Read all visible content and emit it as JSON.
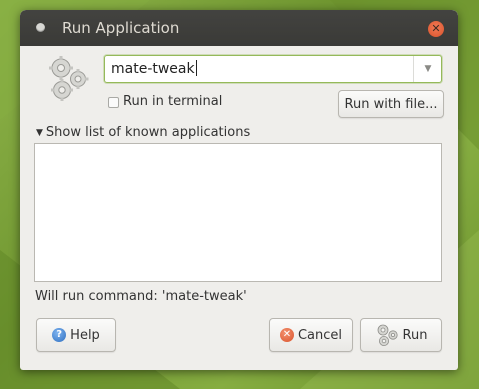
{
  "window": {
    "title": "Run Application",
    "close_glyph": "✕"
  },
  "command": {
    "value": "mate-tweak",
    "dropdown_glyph": "▼"
  },
  "options": {
    "run_in_terminal_label": "Run in terminal",
    "run_in_terminal_checked": false,
    "run_with_file_label": "Run with file..."
  },
  "known_apps": {
    "toggle_label": "Show list of known applications",
    "toggle_glyph": "▼",
    "items": []
  },
  "status": {
    "will_run_text": "Will run command: 'mate-tweak'"
  },
  "buttons": {
    "help_label": "Help",
    "help_glyph": "?",
    "cancel_label": "Cancel",
    "cancel_glyph": "✕",
    "run_label": "Run"
  },
  "icons": {
    "app_icon": "gears-icon",
    "help_icon": "help-icon",
    "cancel_icon": "cancel-icon",
    "run_icon": "gears-icon"
  },
  "colors": {
    "desktop_bg": "#7a9e3a",
    "titlebar": "#3d3d3a",
    "window_bg": "#efeeeb",
    "focus_border": "#95b95a",
    "close_button": "#e0603a"
  }
}
